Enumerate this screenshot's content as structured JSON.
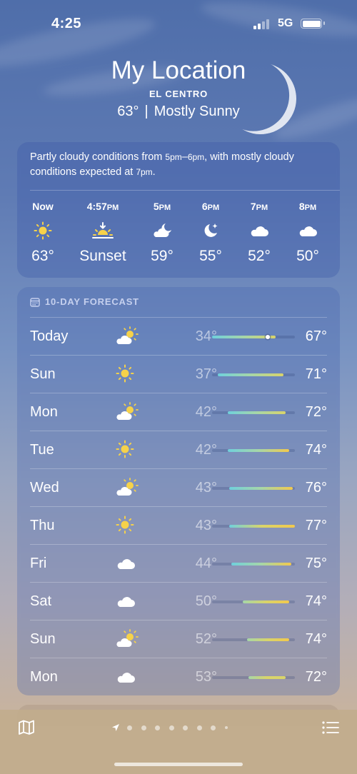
{
  "status_bar": {
    "time": "4:25",
    "network": "5G"
  },
  "header": {
    "city": "My Location",
    "region": "EL CENTRO",
    "temp": "63°",
    "condition": "Mostly Sunny"
  },
  "hourly": {
    "summary_parts": [
      "Partly cloudy conditions from ",
      "5pm",
      "–",
      "6pm",
      ", with mostly cloudy conditions expected at ",
      "7pm",
      "."
    ],
    "hours": [
      {
        "label": "Now",
        "icon": "sun-icon",
        "temp": "63°"
      },
      {
        "label": "4:57",
        "ampm": "PM",
        "icon": "sunset-icon",
        "temp": "Sunset"
      },
      {
        "label": "5",
        "ampm": "PM",
        "icon": "partly-cloudy-night-icon",
        "temp": "59°"
      },
      {
        "label": "6",
        "ampm": "PM",
        "icon": "moon-stars-icon",
        "temp": "55°"
      },
      {
        "label": "7",
        "ampm": "PM",
        "icon": "cloud-icon",
        "temp": "52°"
      },
      {
        "label": "8",
        "ampm": "PM",
        "icon": "cloud-icon",
        "temp": "50°"
      }
    ]
  },
  "forecast": {
    "title": "10-DAY FORECAST",
    "range": {
      "min": 34,
      "max": 77
    },
    "current_temp": 63,
    "days": [
      {
        "day": "Today",
        "icon": "partly-sunny-icon",
        "low": 34,
        "high": 67,
        "low_label": "34°",
        "high_label": "67°"
      },
      {
        "day": "Sun",
        "icon": "sun-icon",
        "low": 37,
        "high": 71,
        "low_label": "37°",
        "high_label": "71°"
      },
      {
        "day": "Mon",
        "icon": "partly-sunny-icon",
        "low": 42,
        "high": 72,
        "low_label": "42°",
        "high_label": "72°"
      },
      {
        "day": "Tue",
        "icon": "sun-icon",
        "low": 42,
        "high": 74,
        "low_label": "42°",
        "high_label": "74°"
      },
      {
        "day": "Wed",
        "icon": "partly-sunny-icon",
        "low": 43,
        "high": 76,
        "low_label": "43°",
        "high_label": "76°"
      },
      {
        "day": "Thu",
        "icon": "sun-icon",
        "low": 43,
        "high": 77,
        "low_label": "43°",
        "high_label": "77°"
      },
      {
        "day": "Fri",
        "icon": "cloud-icon",
        "low": 44,
        "high": 75,
        "low_label": "44°",
        "high_label": "75°"
      },
      {
        "day": "Sat",
        "icon": "cloud-icon",
        "low": 50,
        "high": 74,
        "low_label": "50°",
        "high_label": "74°"
      },
      {
        "day": "Sun",
        "icon": "partly-sunny-icon",
        "low": 52,
        "high": 74,
        "low_label": "52°",
        "high_label": "74°"
      },
      {
        "day": "Mon",
        "icon": "cloud-icon",
        "low": 53,
        "high": 72,
        "low_label": "53°",
        "high_label": "72°"
      }
    ]
  },
  "toolbar": {
    "page_count": 9,
    "current_page": 0
  },
  "colors": {
    "sun": "#f6d24a",
    "bar_cool": "#6fd0dc",
    "bar_mid": "#a6d6a8",
    "bar_warm": "#f2c94c"
  }
}
